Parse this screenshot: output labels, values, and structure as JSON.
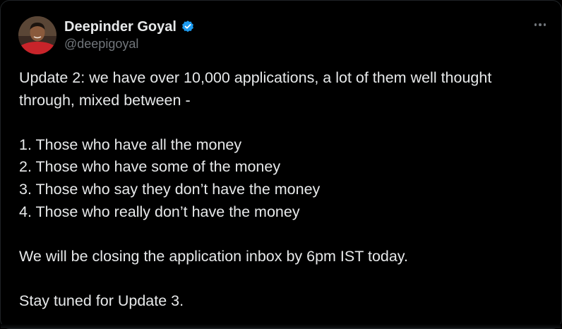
{
  "tweet": {
    "author": {
      "display_name": "Deepinder Goyal",
      "handle": "@deepigoyal",
      "verified": true,
      "avatar_icon": "profile-photo"
    },
    "more_icon": "more-horizontal-icon",
    "text": {
      "line1": "Update 2: we have over 10,000 applications, a lot of them well thought through, mixed between -",
      "list": [
        "1. Those who have all the money",
        "2. Those who have some of the money",
        "3. Those who say they don’t have the money",
        "4. Those who really don’t have the money"
      ],
      "closing": "We will be closing the application inbox by 6pm IST today.",
      "signoff": "Stay tuned for Update 3."
    }
  },
  "colors": {
    "background": "#000000",
    "text_primary": "#e7e9ea",
    "text_secondary": "#71767b",
    "verified_blue": "#1d9bf0"
  }
}
